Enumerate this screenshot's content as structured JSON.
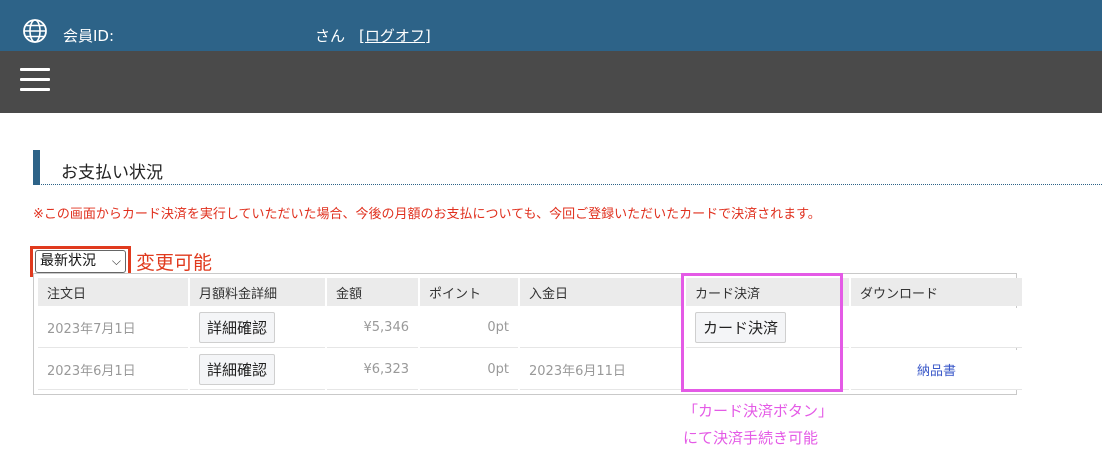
{
  "header": {
    "icon": "globe-icon",
    "member_label": "会員ID:",
    "member_name": "さん",
    "logoff": "[ログオフ]"
  },
  "nav": {
    "menu_icon": "hamburger-menu-icon"
  },
  "section": {
    "title": "お支払い状況"
  },
  "notice": "※この画面からカード決済を実行していただいた場合、今後の月額のお支払についても、今回ご登録いただいたカードで決済されます。",
  "filter": {
    "selected": "最新状況",
    "annotation": "変更可能"
  },
  "table": {
    "headers": [
      "注文日",
      "月額料金詳細",
      "金額",
      "ポイント",
      "入金日",
      "カード決済",
      "ダウンロード"
    ],
    "rows": [
      {
        "order_date": "2023年7月1日",
        "detail_button": "詳細確認",
        "amount": "¥5,346",
        "points": "0pt",
        "paid_date": "",
        "card_button": "カード決済",
        "download": ""
      },
      {
        "order_date": "2023年6月1日",
        "detail_button": "詳細確認",
        "amount": "¥6,323",
        "points": "0pt",
        "paid_date": "2023年6月11日",
        "card_button": "",
        "download": "納品書"
      }
    ]
  },
  "annotation": {
    "line1": "「カード決済ボタン」",
    "line2": "にて決済手続き可能"
  },
  "colors": {
    "header_bg": "#2d6388",
    "nav_bg": "#4a4a4a",
    "notice": "#e0301e",
    "highlight_red": "#e03a1e",
    "highlight_pink": "#e45ae6",
    "link": "#3a58c8"
  }
}
